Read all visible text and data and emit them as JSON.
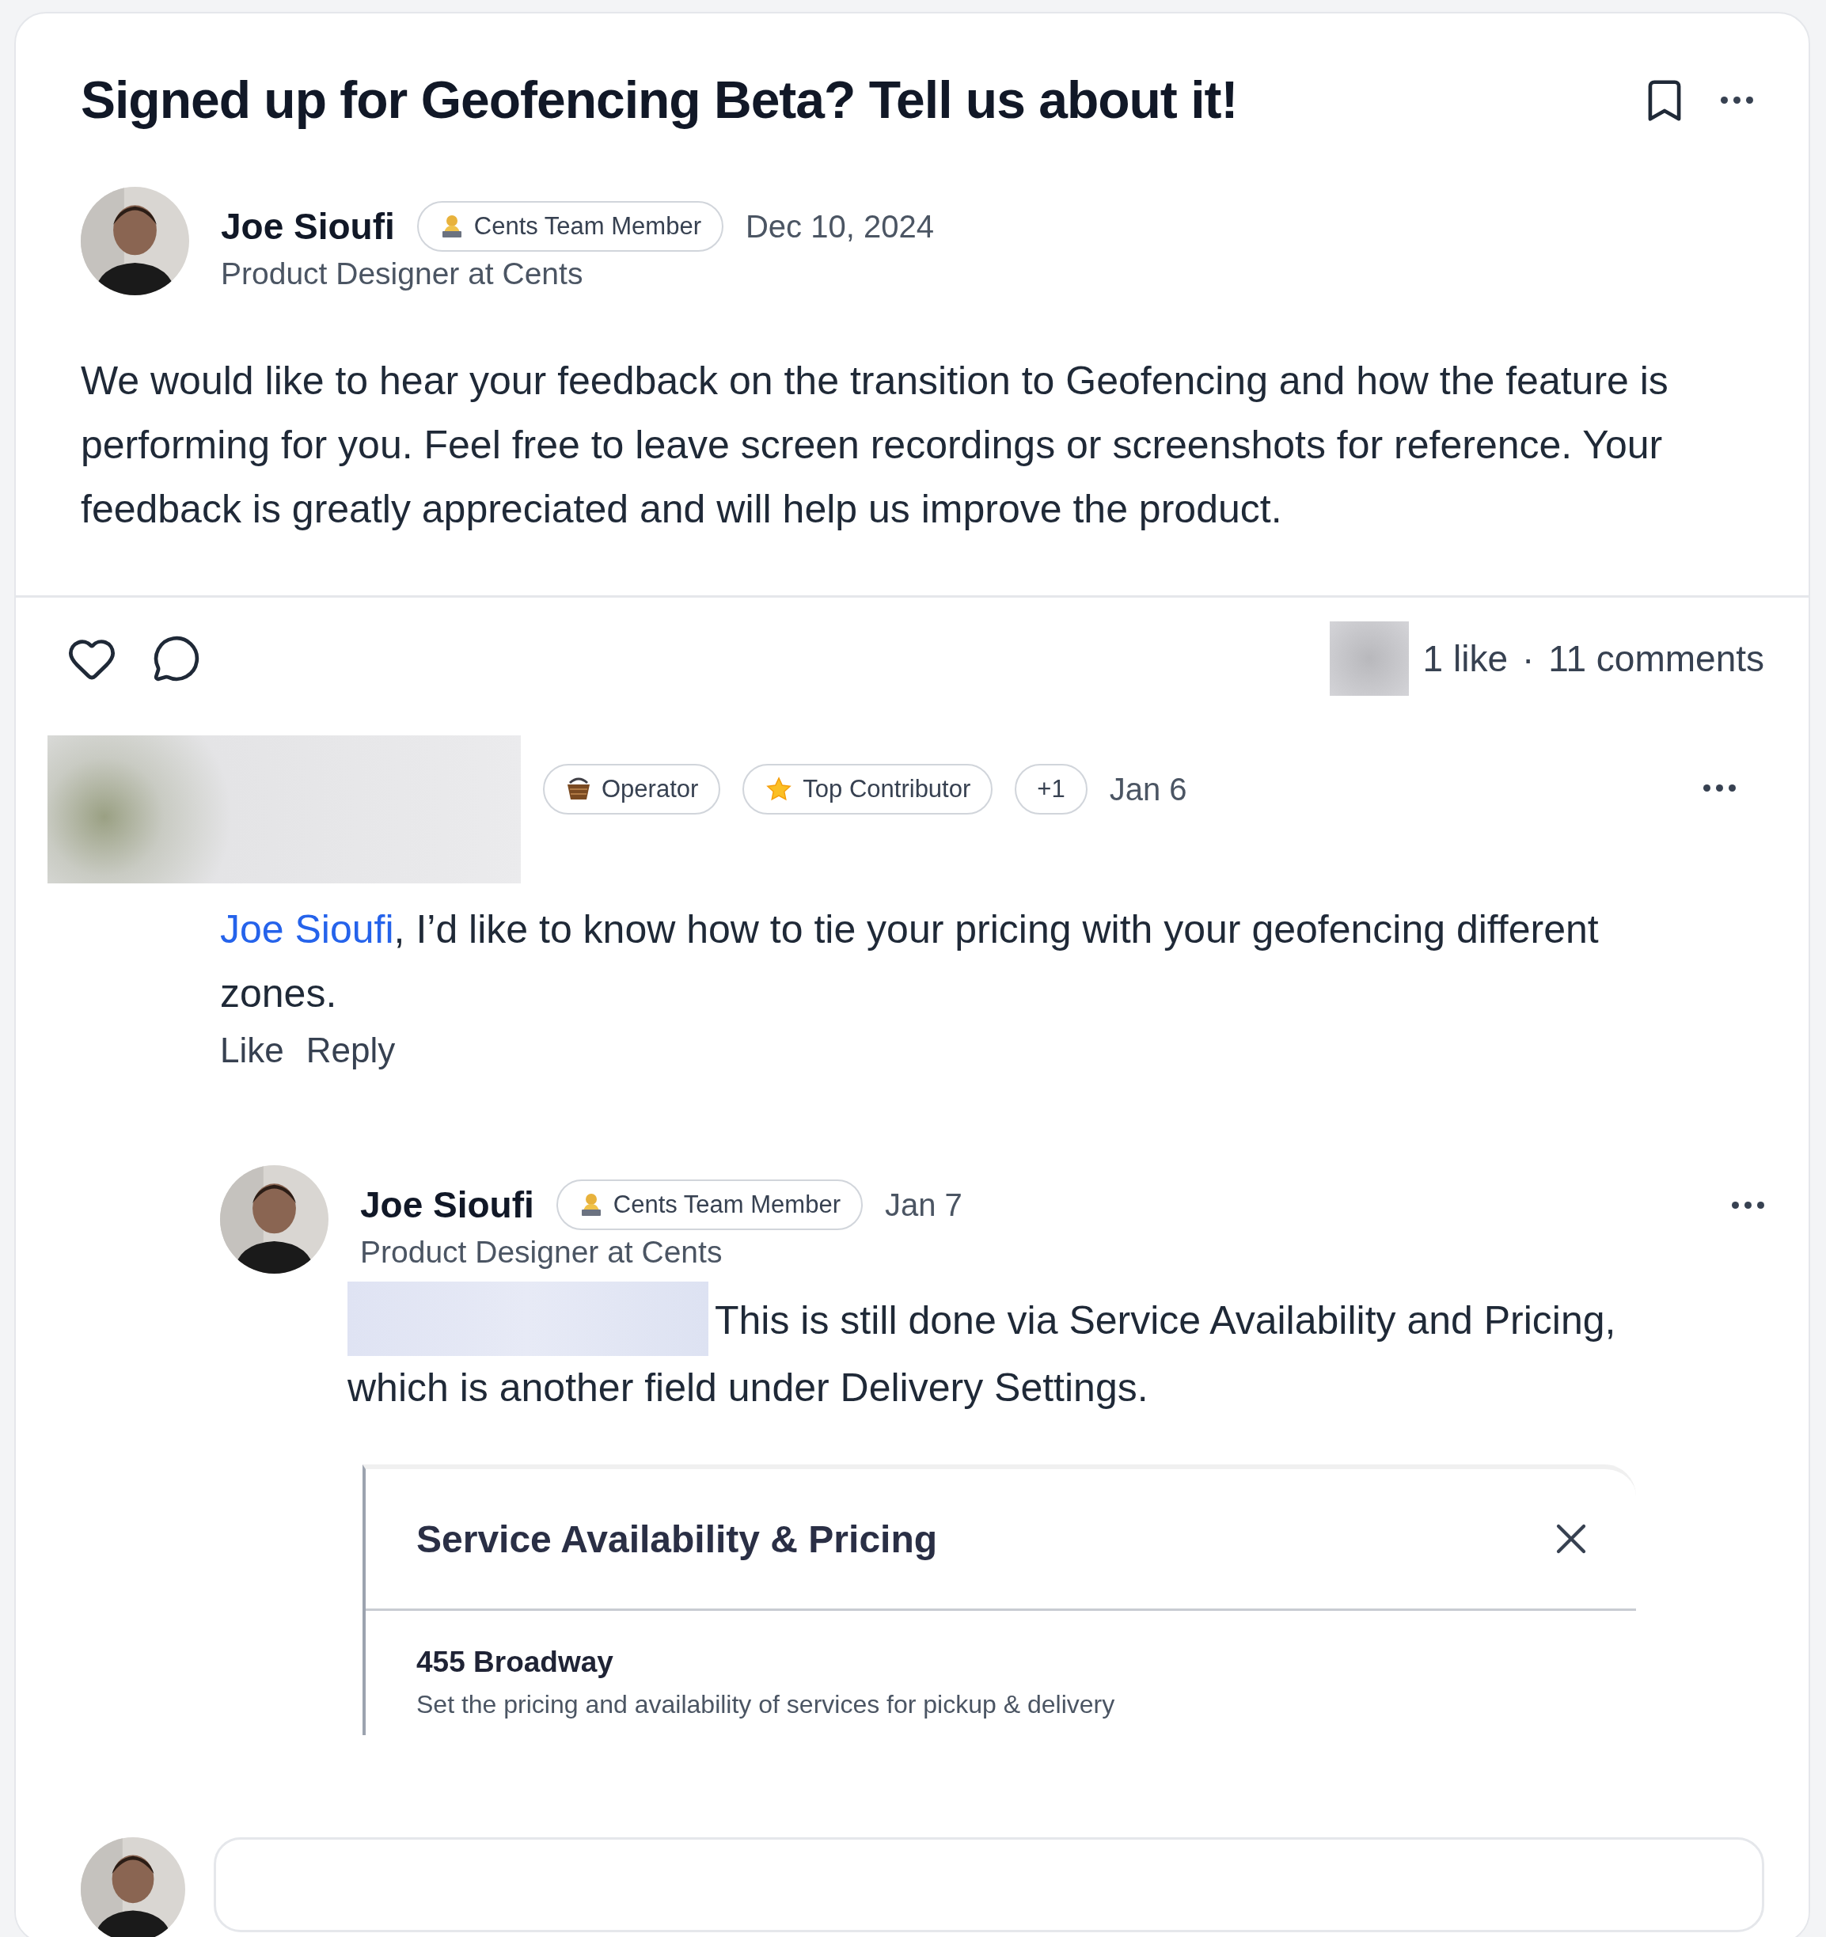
{
  "post": {
    "title": "Signed up for Geofencing Beta? Tell us about it!",
    "author": {
      "name": "Joe Sioufi",
      "badges": [
        {
          "kind": "team",
          "label": "Cents Team Member"
        }
      ],
      "date": "Dec 10, 2024",
      "role": "Product Designer at Cents"
    },
    "body": "We would like to hear your feedback on the transition to Geofencing and how the feature is performing for you. Feel free to leave screen recordings or screenshots for reference. Your feedback is greatly appreciated and will help us improve the product."
  },
  "stats": {
    "likes": "1 like",
    "separator": "·",
    "comments": "11 comments"
  },
  "comments": [
    {
      "badges": [
        {
          "kind": "operator",
          "label": "Operator"
        },
        {
          "kind": "star",
          "label": "Top Contributor"
        },
        {
          "kind": "count",
          "label": "+1"
        }
      ],
      "date": "Jan 6",
      "mention": "Joe Sioufi",
      "text": ", I’d like to know how to tie your pricing with your geofencing different zones.",
      "actions": [
        "Like",
        "Reply"
      ],
      "replies": [
        {
          "name": "Joe Sioufi",
          "badges": [
            {
              "kind": "team",
              "label": "Cents Team Member"
            }
          ],
          "date": "Jan 7",
          "role": "Product Designer at Cents",
          "text": "This is still done via Service Availability and Pricing, which is another field under Delivery Settings.",
          "attachment": {
            "title": "Service Availability & Pricing",
            "heading": "455 Broadway",
            "subtext": "Set the pricing and availability of services for pickup & delivery"
          }
        }
      ]
    }
  ]
}
